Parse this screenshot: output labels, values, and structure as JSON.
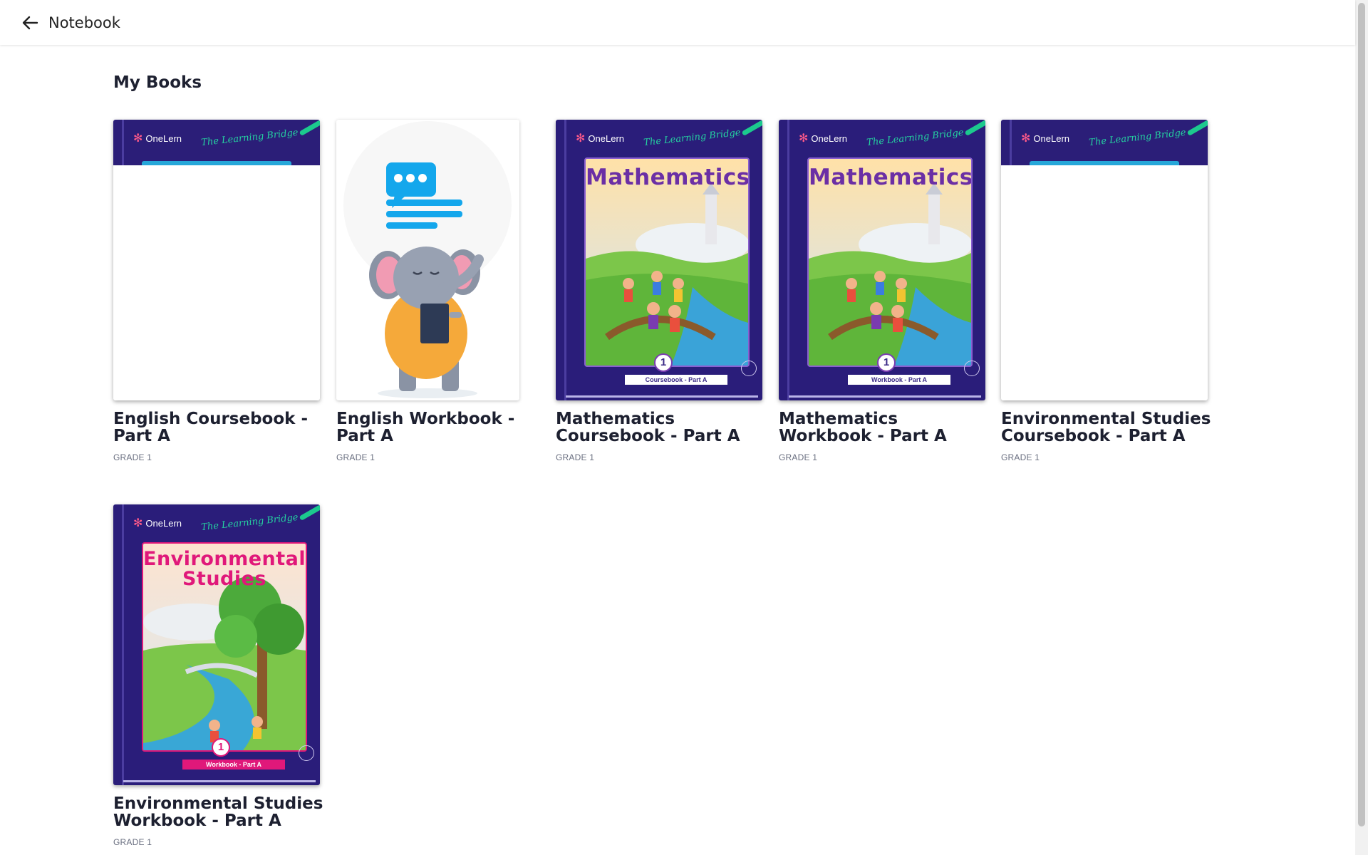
{
  "header": {
    "title": "Notebook"
  },
  "section": {
    "title": "My Books"
  },
  "books": [
    {
      "title": "English Coursebook - Part A",
      "grade": "GRADE 1"
    },
    {
      "title": "English Workbook - Part A",
      "grade": "GRADE 1"
    },
    {
      "title": "Mathematics Coursebook - Part A",
      "grade": "GRADE 1"
    },
    {
      "title": "Mathematics Workbook - Part A",
      "grade": "GRADE 1"
    },
    {
      "title": "Environmental Studies Coursebook - Part A",
      "grade": "GRADE 1"
    },
    {
      "title": "Environmental Studies Workbook - Part A",
      "grade": "GRADE 1"
    }
  ],
  "cover": {
    "brand": "OneLern",
    "tagline": "The Learning Bridge",
    "math_title": "Mathematics",
    "evs_title_1": "Environmental",
    "evs_title_2": "Studies",
    "grade_number": "1",
    "coursebook_ribbon": "Coursebook - Part A",
    "workbook_ribbon": "Workbook - Part A"
  },
  "colors": {
    "cover_navy": "#2a1d7a",
    "tagline_green": "#25d0a0",
    "math_purple": "#6b2fa5",
    "evs_pink": "#e0187a"
  }
}
